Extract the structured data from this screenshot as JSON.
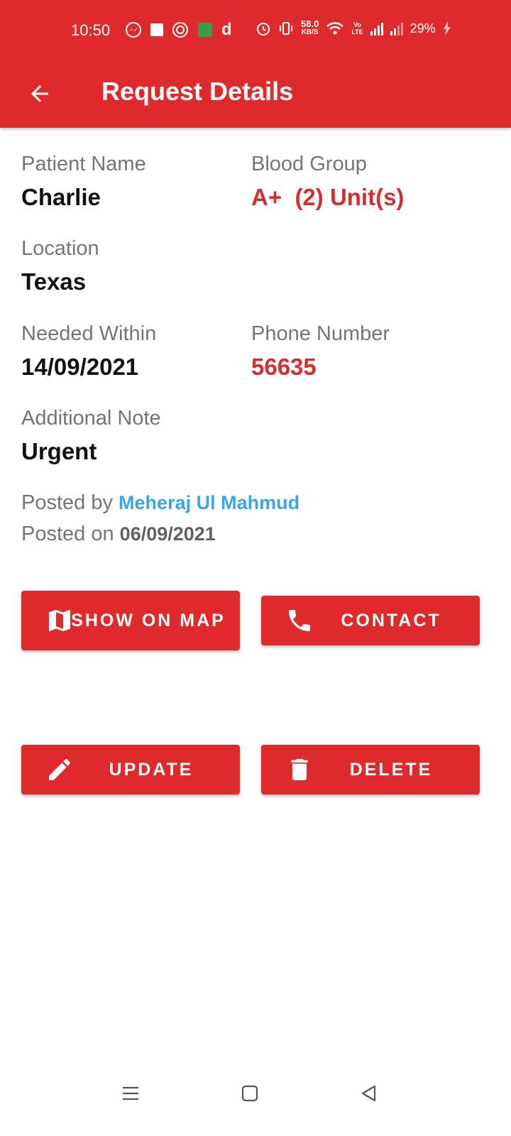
{
  "status_bar": {
    "time": "10:50",
    "network_speed_value": "58.0",
    "network_speed_unit": "KB/S",
    "volte_top": "Vo",
    "volte_bottom": "LTE",
    "battery": "29%"
  },
  "app_bar": {
    "title": "Request Details"
  },
  "details": {
    "patient_name_label": "Patient Name",
    "patient_name": "Charlie",
    "blood_group_label": "Blood Group",
    "blood_group": "A+  (2) Unit(s)",
    "location_label": "Location",
    "location": "Texas",
    "needed_within_label": "Needed Within",
    "needed_within": "14/09/2021",
    "phone_label": "Phone Number",
    "phone": "56635",
    "note_label": "Additional Note",
    "note": "Urgent",
    "posted_by_label": "Posted by",
    "posted_by": "Meheraj Ul Mahmud",
    "posted_on_label": "Posted on",
    "posted_on": "06/09/2021"
  },
  "buttons": {
    "show_on_map": "SHOW ON MAP",
    "contact": "CONTACT",
    "update": "UPDATE",
    "delete": "DELETE"
  },
  "colors": {
    "primary": "#df2a2d",
    "accent_text": "#d32f2f",
    "link": "#3aa5e8"
  },
  "icons": {
    "back": "arrow-left-icon",
    "map": "map-icon",
    "contact": "phone-icon",
    "update": "pencil-icon",
    "delete": "trash-icon"
  }
}
